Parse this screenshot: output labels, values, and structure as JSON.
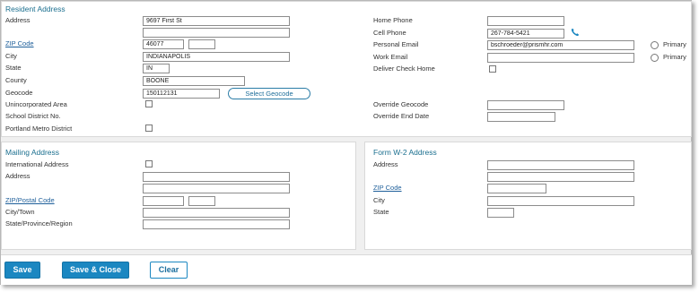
{
  "resident": {
    "title": "Resident Address",
    "address_label": "Address",
    "address_line1": "9697 First St",
    "address_line2": "",
    "zip_label": "ZIP Code",
    "zip": "46077",
    "zip_ext": "",
    "city_label": "City",
    "city": "INDIANAPOLIS",
    "state_label": "State",
    "state": "IN",
    "county_label": "County",
    "county": "BOONE",
    "geocode_label": "Geocode",
    "geocode": "150112131",
    "select_geocode_label": "Select Geocode",
    "unincorporated_label": "Unincorporated Area",
    "school_district_label": "School District No.",
    "portland_label": "Portland Metro District",
    "home_phone_label": "Home Phone",
    "home_phone": "",
    "cell_phone_label": "Cell Phone",
    "cell_phone": "267-784-5421",
    "personal_email_label": "Personal Email",
    "personal_email": "bschroeder@prismhr.com",
    "primary_label_1": "Primary",
    "work_email_label": "Work Email",
    "work_email": "",
    "primary_label_2": "Primary",
    "deliver_check_label": "Deliver Check Home",
    "override_geocode_label": "Override Geocode",
    "override_geocode": "",
    "override_end_label": "Override End Date",
    "override_end": ""
  },
  "mailing": {
    "title": "Mailing Address",
    "international_label": "International Address",
    "address_label": "Address",
    "address_line1": "",
    "address_line2": "",
    "zip_label": "ZIP/Postal Code",
    "zip": "",
    "zip_ext": "",
    "city_label": "City/Town",
    "city": "",
    "state_label": "State/Province/Region",
    "state": ""
  },
  "w2": {
    "title": "Form W-2 Address",
    "address_label": "Address",
    "address_line1": "",
    "address_line2": "",
    "zip_label": "ZIP Code",
    "zip": "",
    "city_label": "City",
    "city": "",
    "state_label": "State",
    "state": ""
  },
  "actions": {
    "save": "Save",
    "save_close": "Save & Close",
    "clear": "Clear"
  },
  "colors": {
    "accent": "#1b87c1",
    "section_title": "#1b6f8f",
    "link": "#1e5f9a"
  },
  "icons": {
    "phone": "phone-icon"
  }
}
